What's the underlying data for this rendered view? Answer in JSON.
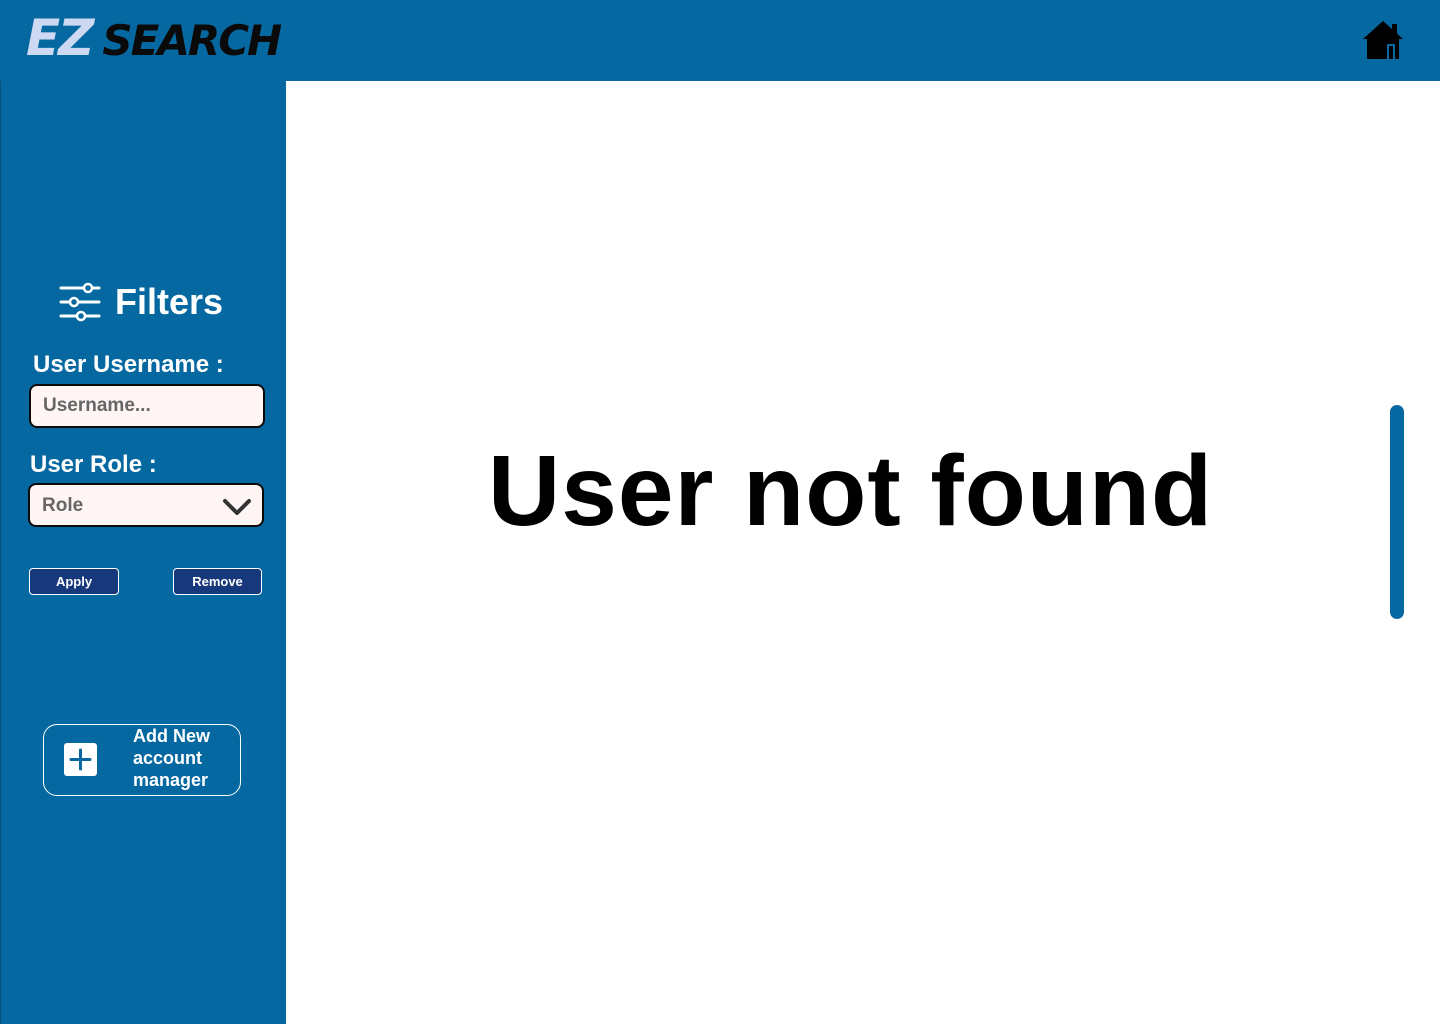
{
  "header": {
    "logo_ez": "EZ",
    "logo_search": "SEARCH",
    "home_icon": "home-icon"
  },
  "sidebar": {
    "filters_title": "Filters",
    "filters_icon": "sliders-icon",
    "username_label": "User Username :",
    "username_placeholder": "Username...",
    "username_value": "",
    "role_label": "User Role :",
    "role_value": "Role",
    "role_icon": "chevron-down-icon",
    "apply_label": "Apply",
    "remove_label": "Remove",
    "add_manager_label": "Add New account manager",
    "add_icon": "plus-square-icon"
  },
  "main": {
    "message": "User not found"
  },
  "colors": {
    "primary": "#0668a1",
    "button_dark": "#17387a",
    "logo_light": "#cdd8f2",
    "input_bg": "#fff5f5"
  }
}
